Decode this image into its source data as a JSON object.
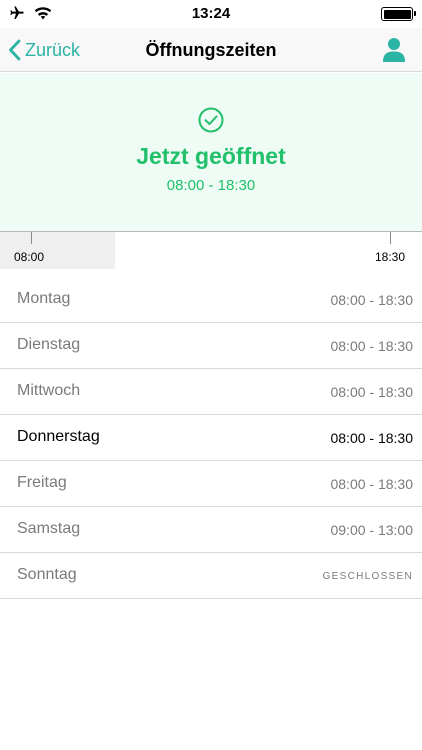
{
  "status_bar": {
    "time": "13:24",
    "battery_percent": 100
  },
  "nav": {
    "back_label": "Zurück",
    "title": "Öffnungszeiten"
  },
  "banner": {
    "status_label": "Jetzt geöffnet",
    "hours": "08:00 - 18:30",
    "color": "#21c06a",
    "background": "#effbf5"
  },
  "timeline": {
    "start_label": "08:00",
    "end_label": "18:30"
  },
  "days": [
    {
      "name": "Montag",
      "hours": "08:00 - 18:30"
    },
    {
      "name": "Dienstag",
      "hours": "08:00 - 18:30"
    },
    {
      "name": "Mittwoch",
      "hours": "08:00 - 18:30"
    },
    {
      "name": "Donnerstag",
      "hours": "08:00 - 18:30"
    },
    {
      "name": "Freitag",
      "hours": "08:00 - 18:30"
    },
    {
      "name": "Samstag",
      "hours": "09:00 - 13:00"
    },
    {
      "name": "Sonntag",
      "hours": "GESCHLOSSEN"
    }
  ],
  "accent_color": "#2bb3a4",
  "icons": [
    "airplane-icon",
    "wifi-icon",
    "battery-icon",
    "chevron-left-icon",
    "profile-icon",
    "check-circle-icon"
  ]
}
